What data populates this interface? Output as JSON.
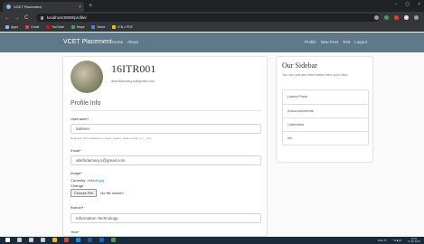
{
  "browser": {
    "tab_title": "VCET Placement",
    "tab_close": "×",
    "new_tab": "+",
    "window_controls": [
      "–",
      "▢",
      "×"
    ],
    "nav": {
      "back": "←",
      "forward": "→",
      "reload": "C",
      "home": "⌂"
    },
    "url": "localhost:8000/profile/",
    "bookmarks": [
      {
        "label": "Apps",
        "color": "#8ab4f8"
      },
      {
        "label": "Gmail",
        "color": "#ea4335"
      },
      {
        "label": "YouTube",
        "color": "#ff0000"
      },
      {
        "label": "Maps",
        "color": "#34a853"
      },
      {
        "label": "News",
        "color": "#4285f4"
      },
      {
        "label": "ICN x PDF",
        "color": "#fbbc04"
      }
    ]
  },
  "navbar": {
    "brand": "VCET Placement",
    "left_links": [
      "Home",
      "About"
    ],
    "right_links": [
      "Profile",
      "New Post",
      "Test",
      "Logout"
    ]
  },
  "profile": {
    "username_heading": "16ITR001",
    "email": "abirfirdamary.s@gmail.com",
    "legend": "Profile Info",
    "fields": {
      "username_label": "Username*",
      "username_value": "tariteen",
      "username_help": "Required. 150 characters or fewer. Letters, digits and @/./+/-/_ only.",
      "email_label": "Email*",
      "email_value": "abirfirdamary.s@gmail.com",
      "image_label": "Image*",
      "currently_label": "Currently:",
      "currently_link": "default.jpg",
      "change_label": "Change:",
      "choose_file": "Choose File",
      "no_file": "No file chosen",
      "branch_label": "Branch*",
      "branch_value": "Information Technology",
      "year_label": "Year*"
    }
  },
  "sidebar": {
    "title": "Our Sidebar",
    "text": "You can put any information here you'd like.",
    "items": [
      "Latest Posts",
      "Announcements",
      "Calendars",
      "etc"
    ]
  },
  "taskbar": {
    "icon_colors": [
      "#ffffff",
      "#cccccc",
      "#cccccc",
      "#cccccc",
      "#f2b90f",
      "#e53935",
      "#1e88e5",
      "#2b579a",
      "#1565c0",
      "#43a047"
    ],
    "tray_text": "ENG IN",
    "tray_icons": "^ ⊕ ▮ 🔊",
    "time": "12:01",
    "date": "17-06-2021"
  }
}
